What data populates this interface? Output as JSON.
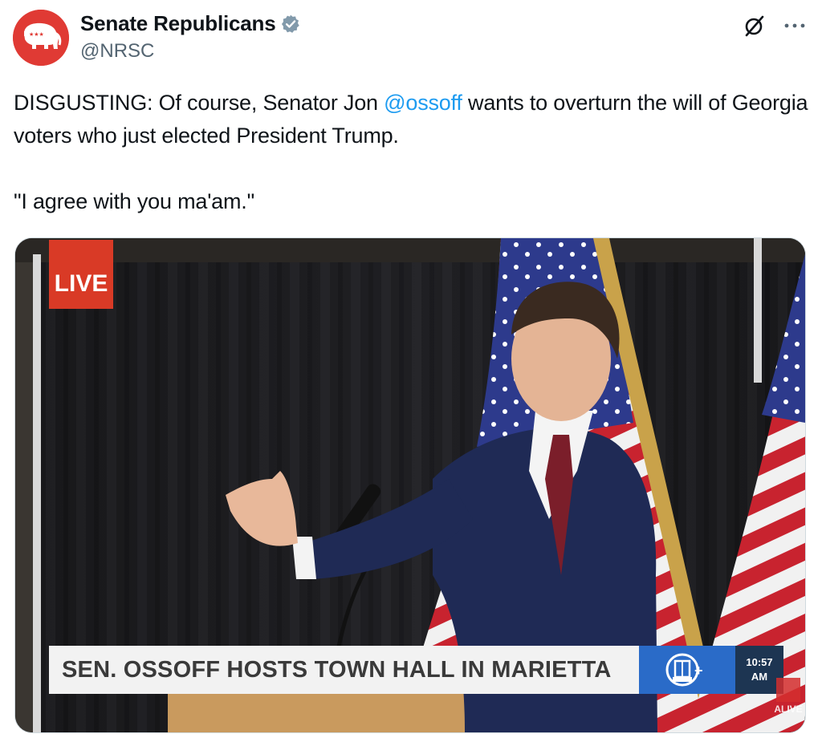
{
  "author": {
    "display_name": "Senate Republicans",
    "handle": "@NRSC",
    "verified": true,
    "avatar_icon": "elephant-logo",
    "avatar_color": "#e03a34"
  },
  "actions": {
    "grok_icon": "grok-icon",
    "more_icon": "more-options-icon"
  },
  "tweet": {
    "line1_before": "DISGUSTING: Of course, Senator Jon ",
    "mention": "@ossoff",
    "line1_after": " wants to overturn the will of Georgia voters who just elected President Trump.",
    "quote": "\"I agree with you ma'am.\""
  },
  "media": {
    "type": "video",
    "live_label": "LIVE",
    "headline": "SEN. OSSOFF HOSTS TOWN HALL IN MARIETTA",
    "station_logo": "ALIVE",
    "time": "10:57",
    "ampm": "AM",
    "bug_label": "ALIVE",
    "accent_color": "#d93a26",
    "logo_color": "#2a6bc8"
  }
}
